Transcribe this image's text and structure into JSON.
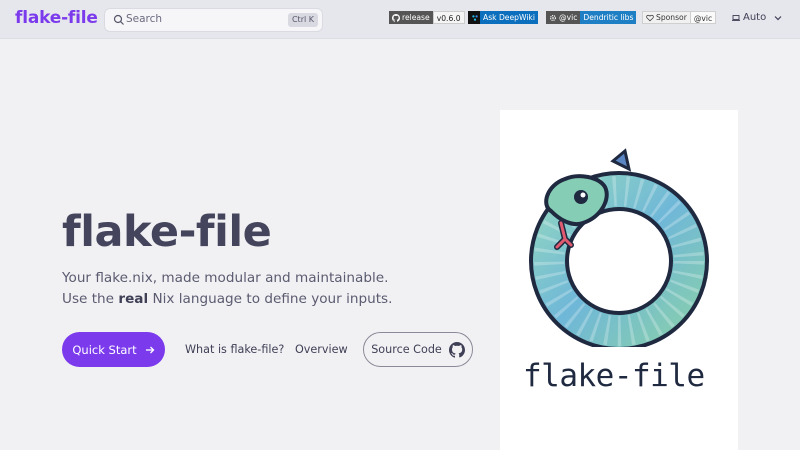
{
  "header": {
    "site_title": "flake-file",
    "search": {
      "placeholder": "Search",
      "shortcut": "Ctrl K"
    },
    "badges": [
      {
        "icon": "github-icon",
        "label": "release",
        "value": "v0.6.0",
        "color": "#555555"
      },
      {
        "icon": "deepwiki-icon",
        "label": "Ask DeepWiki",
        "color": "#0b6fbd"
      },
      {
        "icon": "gear-icon",
        "label": "@vic",
        "value": "Dendritic libs",
        "color": "#1f7fc4"
      },
      {
        "icon": "heart-icon",
        "label": "Sponsor",
        "value": "@vic"
      }
    ],
    "theme": {
      "label": "Auto"
    }
  },
  "hero": {
    "title": "flake-file",
    "tagline_line1": "Your flake.nix, made modular and maintainable.",
    "tagline_line2_pre": "Use the ",
    "tagline_line2_bold": "real",
    "tagline_line2_post": " Nix language to define your inputs.",
    "actions": {
      "primary": "Quick Start",
      "link1": "What is flake-file?",
      "link2": "Overview",
      "source": "Source Code"
    }
  },
  "logo": {
    "text": "flake-file"
  },
  "colors": {
    "accent": "#7c3aed",
    "background": "#f1f1f4",
    "header": "#e6e7ed"
  }
}
